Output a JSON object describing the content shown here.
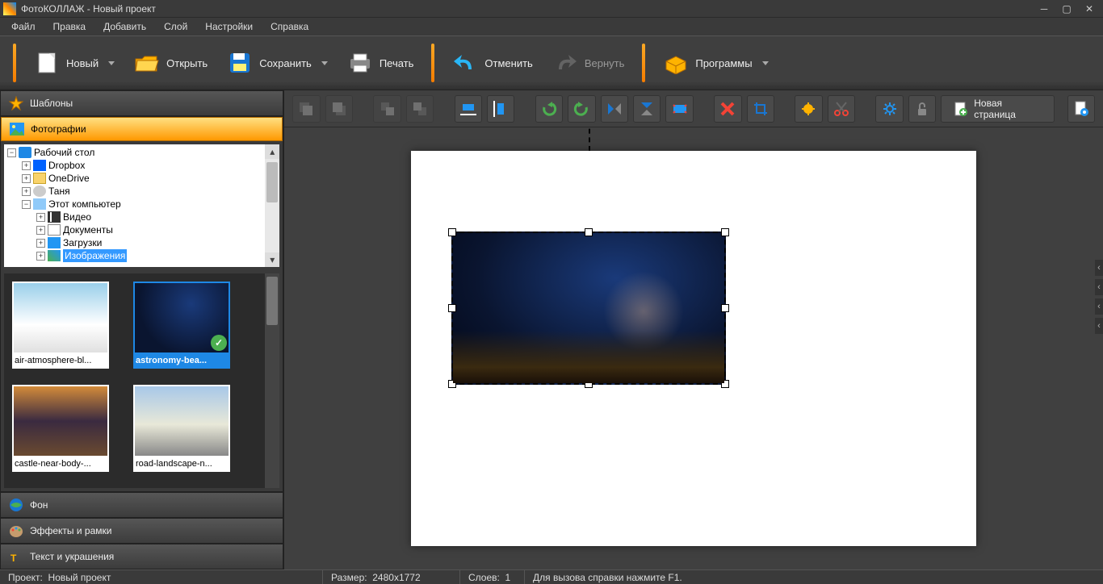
{
  "title": "ФотоКОЛЛАЖ - Новый проект",
  "menu": [
    "Файл",
    "Правка",
    "Добавить",
    "Слой",
    "Настройки",
    "Справка"
  ],
  "toolbar": {
    "new": "Новый",
    "open": "Открыть",
    "save": "Сохранить",
    "print": "Печать",
    "undo": "Отменить",
    "redo": "Вернуть",
    "programs": "Программы"
  },
  "side": {
    "templates": "Шаблоны",
    "photos": "Фотографии",
    "background": "Фон",
    "effects": "Эффекты и рамки",
    "text": "Текст и украшения"
  },
  "tree": {
    "desktop": "Рабочий стол",
    "dropbox": "Dropbox",
    "onedrive": "OneDrive",
    "user": "Таня",
    "thispc": "Этот компьютер",
    "video": "Видео",
    "docs": "Документы",
    "downloads": "Загрузки",
    "pictures": "Изображения"
  },
  "thumbs": [
    {
      "caption": "air-atmosphere-bl..."
    },
    {
      "caption": "astronomy-bea...",
      "selected": true
    },
    {
      "caption": "castle-near-body-..."
    },
    {
      "caption": "road-landscape-n..."
    }
  ],
  "tool_row": {
    "new_page": "Новая страница"
  },
  "status": {
    "project_label": "Проект:",
    "project_name": "Новый проект",
    "size_label": "Размер:",
    "size_value": "2480x1772",
    "layers_label": "Слоев:",
    "layers_value": "1",
    "help": "Для вызова справки нажмите F1."
  }
}
